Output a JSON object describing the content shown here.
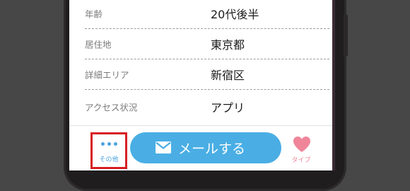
{
  "profile": {
    "rows": [
      {
        "label": "年齢",
        "value": "20代後半"
      },
      {
        "label": "居住地",
        "value": "東京都"
      },
      {
        "label": "詳細エリア",
        "value": "新宿区"
      },
      {
        "label": "アクセス状況",
        "value": "アプリ"
      }
    ]
  },
  "bottom_bar": {
    "more_label": "その他",
    "more_icon": "ellipsis-icon",
    "mail_label": "メールする",
    "mail_icon": "envelope-icon",
    "type_label": "タイプ",
    "type_icon": "heart-icon"
  },
  "colors": {
    "accent_blue": "#4aaee4",
    "highlight_red": "#d81f23",
    "heart_pink": "#f0859a",
    "background": "#474747"
  }
}
